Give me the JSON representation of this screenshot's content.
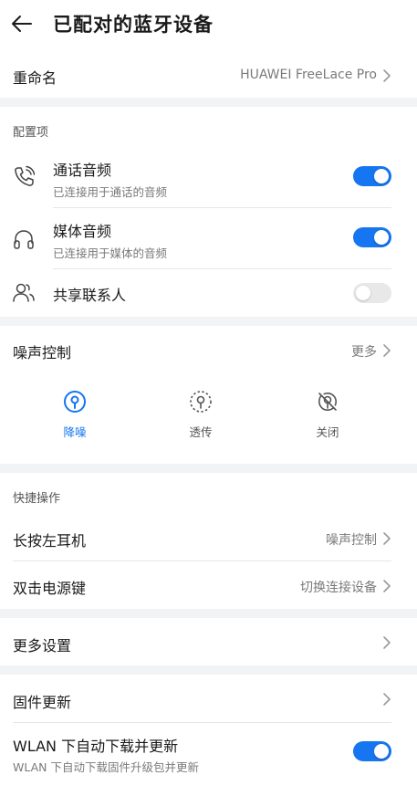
{
  "header": {
    "title": "已配对的蓝牙设备"
  },
  "rename": {
    "label": "重命名",
    "value": "HUAWEI FreeLace Pro"
  },
  "config": {
    "section_title": "配置项",
    "items": [
      {
        "title": "通话音频",
        "subtitle": "已连接用于通话的音频",
        "icon": "phone-icon",
        "enabled": true
      },
      {
        "title": "媒体音频",
        "subtitle": "已连接用于媒体的音频",
        "icon": "headphones-icon",
        "enabled": true
      },
      {
        "title": "共享联系人",
        "subtitle": "",
        "icon": "contacts-icon",
        "enabled": false
      }
    ]
  },
  "noise": {
    "label": "噪声控制",
    "more": "更多",
    "modes": [
      {
        "label": "降噪",
        "selected": true
      },
      {
        "label": "透传",
        "selected": false
      },
      {
        "label": "关闭",
        "selected": false
      }
    ]
  },
  "shortcuts": {
    "section_title": "快捷操作",
    "long_press": {
      "label": "长按左耳机",
      "value": "噪声控制"
    },
    "double_tap": {
      "label": "双击电源键",
      "value": "切换连接设备"
    }
  },
  "more_settings": {
    "label": "更多设置"
  },
  "firmware": {
    "label": "固件更新",
    "wlan_title": "WLAN 下自动下载并更新",
    "wlan_subtitle": "WLAN 下自动下载固件升级包并更新",
    "wlan_enabled": true
  },
  "colors": {
    "accent": "#1675f0",
    "muted": "#7a7a7a",
    "gap": "#f1f3f5"
  }
}
